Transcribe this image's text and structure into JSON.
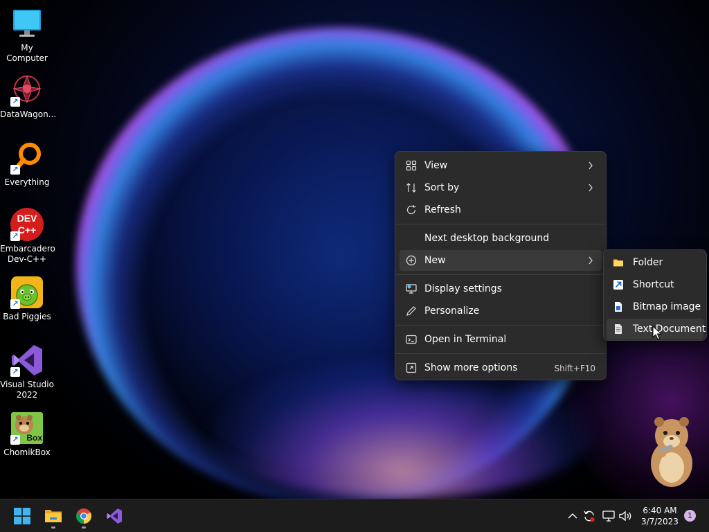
{
  "desktop_icons": [
    {
      "label": "My Computer",
      "icon": "monitor-icon",
      "shortcut": false
    },
    {
      "label": "DataWagon...",
      "icon": "datawagon-icon",
      "shortcut": true
    },
    {
      "label": "Everything",
      "icon": "magnifier-icon",
      "shortcut": true
    },
    {
      "label": "Embarcadero Dev-C++",
      "icon": "devcpp-icon",
      "shortcut": true,
      "icon_text": "DEV C++"
    },
    {
      "label": "Bad Piggies",
      "icon": "pig-icon",
      "shortcut": true
    },
    {
      "label": "Visual Studio 2022",
      "icon": "visual-studio-icon",
      "shortcut": true
    },
    {
      "label": "ChomikBox",
      "icon": "hamster-icon",
      "shortcut": true,
      "icon_text": "Box"
    }
  ],
  "context_menu": {
    "items": [
      {
        "label": "View",
        "icon": "grid-icon",
        "submenu": true
      },
      {
        "label": "Sort by",
        "icon": "sort-icon",
        "submenu": true
      },
      {
        "label": "Refresh",
        "icon": "refresh-icon",
        "submenu": false
      },
      {
        "label": "Next desktop background",
        "icon": "",
        "submenu": false
      },
      {
        "label": "New",
        "icon": "plus-circle-icon",
        "submenu": true,
        "highlighted": true
      },
      {
        "label": "Display settings",
        "icon": "display-icon",
        "submenu": false
      },
      {
        "label": "Personalize",
        "icon": "pen-icon",
        "submenu": false
      },
      {
        "label": "Open in Terminal",
        "icon": "terminal-icon",
        "submenu": false
      },
      {
        "label": "Show more options",
        "icon": "more-options-icon",
        "submenu": false,
        "shortcut": "Shift+F10"
      }
    ]
  },
  "new_submenu": {
    "items": [
      {
        "label": "Folder",
        "icon": "folder-icon"
      },
      {
        "label": "Shortcut",
        "icon": "shortcut-icon"
      },
      {
        "label": "Bitmap image",
        "icon": "bitmap-icon"
      },
      {
        "label": "Text Document",
        "icon": "text-document-icon",
        "highlighted": true
      }
    ]
  },
  "taskbar": {
    "apps": [
      {
        "name": "Start",
        "icon": "windows-start-icon",
        "running": false
      },
      {
        "name": "File Explorer",
        "icon": "file-explorer-icon",
        "running": true
      },
      {
        "name": "Google Chrome",
        "icon": "chrome-icon",
        "running": true
      },
      {
        "name": "Visual Studio",
        "icon": "visual-studio-icon",
        "running": false
      }
    ],
    "tray": {
      "icons": [
        "chevron-up-icon",
        "sync-icon",
        "network-icon",
        "volume-icon"
      ],
      "time": "6:40 AM",
      "date": "3/7/2023",
      "notification_count": "1"
    }
  },
  "colors": {
    "menu_bg": "#2b2b2b",
    "menu_hover": "#3a3a3a",
    "taskbar_bg": "#1c1c1c",
    "accent": "#4cc2ff"
  }
}
